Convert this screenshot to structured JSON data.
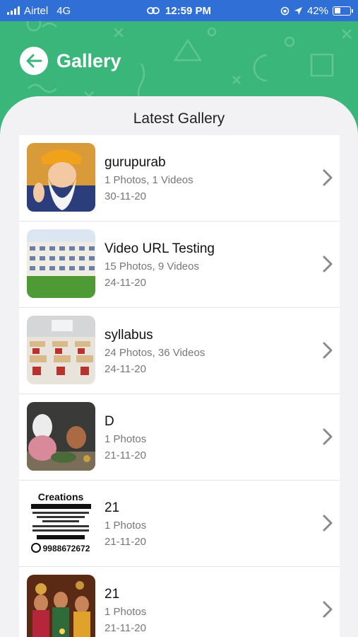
{
  "status_bar": {
    "carrier": "Airtel",
    "network": "4G",
    "time": "12:59 PM",
    "battery": "42%",
    "battery_level": 0.42
  },
  "header": {
    "title": "Gallery",
    "back_icon": "arrow-left-icon"
  },
  "section_title": "Latest Gallery",
  "theme": {
    "primary": "#3bb67a",
    "status_bar": "#2f6fd6"
  },
  "gallery": [
    {
      "title": "gurupurab",
      "subtitle": "1 Photos, 1 Videos",
      "date": "30-11-20",
      "image": "guru-portrait"
    },
    {
      "title": "Video URL Testing",
      "subtitle": "15 Photos, 9 Videos",
      "date": "24-11-20",
      "image": "school-building"
    },
    {
      "title": "syllabus",
      "subtitle": "24 Photos, 36 Videos",
      "date": "24-11-20",
      "image": "classroom"
    },
    {
      "title": "D",
      "subtitle": "1 Photos",
      "date": "21-11-20",
      "image": "people-ceremony"
    },
    {
      "title": "21",
      "subtitle": "1 Photos",
      "date": "21-11-20",
      "image": "creations-flyer",
      "image_text": {
        "line1": "Creations",
        "phone": "9988672672"
      }
    },
    {
      "title": "21",
      "subtitle": "1 Photos",
      "date": "21-11-20",
      "image": "diwali-family"
    }
  ]
}
